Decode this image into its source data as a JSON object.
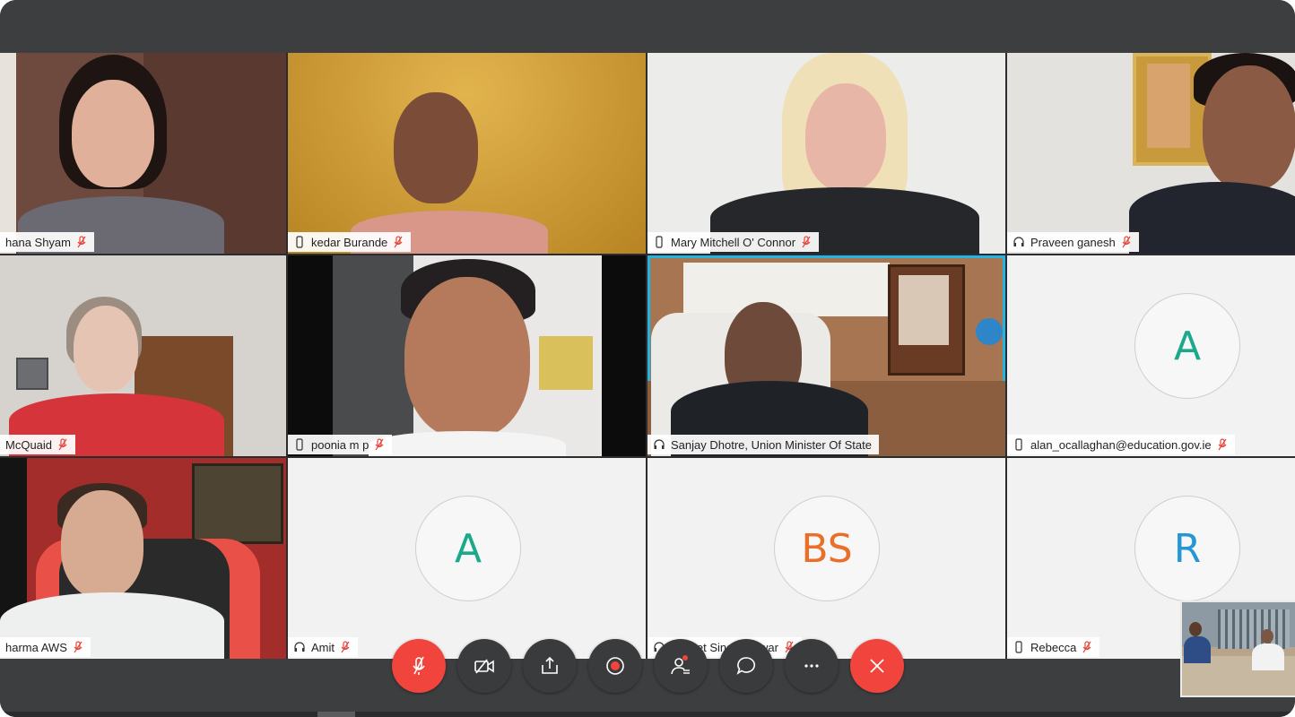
{
  "colors": {
    "chrome": "#3d3e40",
    "active_border": "#25b4e2",
    "danger": "#f0443d",
    "avatar_green": "#1aa98a",
    "avatar_orange": "#e8702a",
    "avatar_blue": "#2497d4"
  },
  "participants": [
    {
      "name": "hana Shyam",
      "device": "none",
      "muted": true
    },
    {
      "name": "kedar Burande",
      "device": "phone-icon",
      "muted": true
    },
    {
      "name": "Mary Mitchell O' Connor",
      "device": "phone-icon",
      "muted": true
    },
    {
      "name": "Praveen ganesh",
      "device": "headset-icon",
      "muted": true
    },
    {
      "name": "McQuaid",
      "device": "none",
      "muted": true
    },
    {
      "name": "poonia m p",
      "device": "phone-icon",
      "muted": true
    },
    {
      "name": "Sanjay Dhotre, Union Minister Of State",
      "device": "headset-icon",
      "muted": false,
      "active_speaker": true
    },
    {
      "name": "alan_ocallaghan@education.gov.ie",
      "device": "phone-icon",
      "muted": true,
      "avatar": "A"
    },
    {
      "name": "harma AWS",
      "device": "none",
      "muted": true
    },
    {
      "name": "Amit",
      "device": "headset-icon",
      "muted": true,
      "avatar": "A"
    },
    {
      "name": "Baljeet Singh Sinwar",
      "device": "headset-icon",
      "muted": true,
      "avatar": "BS"
    },
    {
      "name": "Rebecca",
      "device": "phone-icon",
      "muted": true,
      "avatar": "R"
    }
  ],
  "controls": [
    {
      "name": "mute-button",
      "icon": "mic-off-icon",
      "state": "muted"
    },
    {
      "name": "video-button",
      "icon": "camera-off-icon"
    },
    {
      "name": "share-button",
      "icon": "share-icon"
    },
    {
      "name": "record-button",
      "icon": "record-icon"
    },
    {
      "name": "participants-button",
      "icon": "participants-icon"
    },
    {
      "name": "chat-button",
      "icon": "chat-icon"
    },
    {
      "name": "more-button",
      "icon": "more-icon"
    },
    {
      "name": "leave-button",
      "icon": "close-icon"
    }
  ]
}
